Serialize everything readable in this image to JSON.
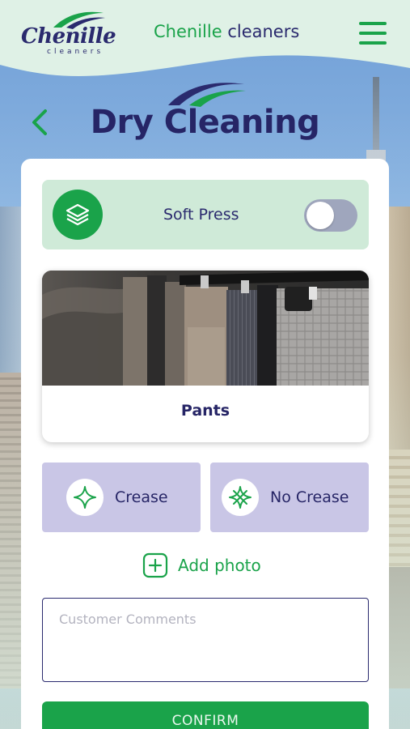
{
  "header": {
    "logo_text": "Chenille",
    "logo_sub": "cleaners",
    "app_title_brand": "Chenille",
    "app_title_rest": "cleaners",
    "menu_icon": "hamburger-menu-icon"
  },
  "page": {
    "title": "Dry Cleaning",
    "back_icon": "chevron-left-icon"
  },
  "press_option": {
    "label": "Soft Press",
    "icon": "layers-icon",
    "enabled": false
  },
  "item": {
    "label": "Pants"
  },
  "crease_options": [
    {
      "label": "Crease",
      "icon": "sparkle-icon"
    },
    {
      "label": "No Crease",
      "icon": "sparkle-crossed-icon"
    }
  ],
  "add_photo": {
    "label": "Add photo",
    "icon": "plus-square-icon"
  },
  "comments": {
    "placeholder": "Customer Comments",
    "value": ""
  },
  "confirm": {
    "label": "CONFIRM"
  },
  "colors": {
    "brand_green": "#1aa34a",
    "navy": "#262566",
    "mint": "#cfead8",
    "lavender": "#c9c6e6"
  }
}
